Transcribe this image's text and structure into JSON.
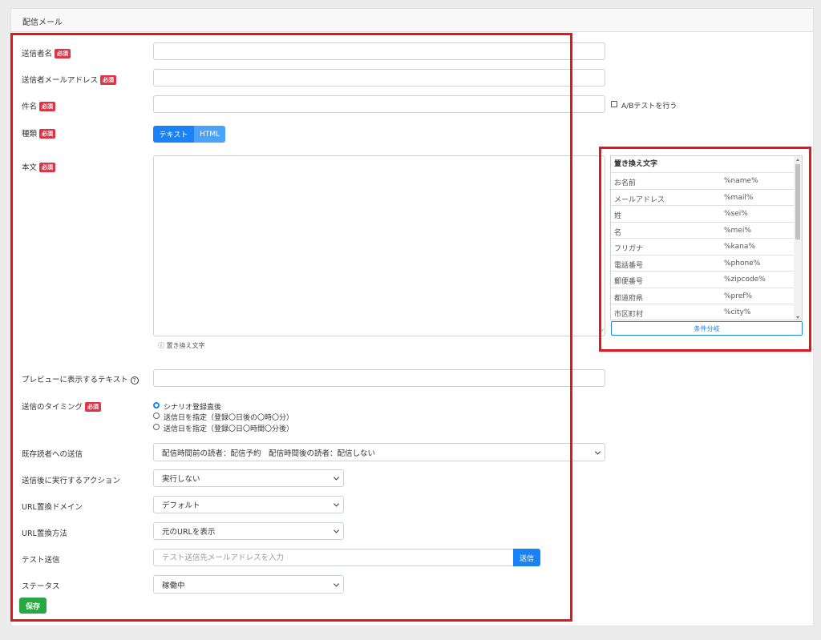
{
  "header": {
    "title": "配信メール"
  },
  "badges": {
    "required": "必須"
  },
  "form": {
    "sender_name": {
      "label": "送信者名",
      "value": ""
    },
    "sender_email": {
      "label": "送信者メールアドレス",
      "value": ""
    },
    "subject": {
      "label": "件名",
      "value": ""
    },
    "ab_test": {
      "label": "A/Bテストを行う",
      "checked": false
    },
    "type": {
      "label": "種類",
      "options": [
        "テキスト",
        "HTML"
      ],
      "selected": "テキスト"
    },
    "body": {
      "label": "本文",
      "value": "",
      "hint": "ⓘ 置き換え文字"
    },
    "preview_text": {
      "label": "プレビューに表示するテキスト",
      "value": "",
      "help_icon": "question-circle-icon"
    },
    "timing": {
      "label": "送信のタイミング",
      "options": [
        "シナリオ登録直後",
        "送信日を指定（登録〇日後の〇時〇分）",
        "送信日を指定（登録〇日〇時間〇分後）"
      ],
      "selected_index": 0
    },
    "existing_readers": {
      "label": "既存読者への送信",
      "value": "配信時間前の読者：配信予約　配信時間後の読者：配信しない"
    },
    "post_action": {
      "label": "送信後に実行するアクション",
      "value": "実行しない"
    },
    "url_domain": {
      "label": "URL置換ドメイン",
      "value": "デフォルト"
    },
    "url_method": {
      "label": "URL置換方法",
      "value": "元のURLを表示"
    },
    "test_send": {
      "label": "テスト送信",
      "placeholder": "テスト送信先メールアドレスを入力",
      "button": "送信"
    },
    "status": {
      "label": "ステータス",
      "value": "稼働中"
    },
    "save_button": "保存"
  },
  "replace_panel": {
    "title": "置き換え文字",
    "rows": [
      {
        "name": "お名前",
        "code": "%name%"
      },
      {
        "name": "メールアドレス",
        "code": "%mail%"
      },
      {
        "name": "姓",
        "code": "%sei%"
      },
      {
        "name": "名",
        "code": "%mei%"
      },
      {
        "name": "フリガナ",
        "code": "%kana%"
      },
      {
        "name": "電話番号",
        "code": "%phone%"
      },
      {
        "name": "郵便番号",
        "code": "%zipcode%"
      },
      {
        "name": "都道府県",
        "code": "%pref%"
      },
      {
        "name": "市区町村",
        "code": "%city%"
      }
    ],
    "condition_button": "条件分岐"
  },
  "colors": {
    "primary": "#1a82f7",
    "success": "#28a745",
    "danger": "#dc3545",
    "highlight": "#e3161d"
  }
}
